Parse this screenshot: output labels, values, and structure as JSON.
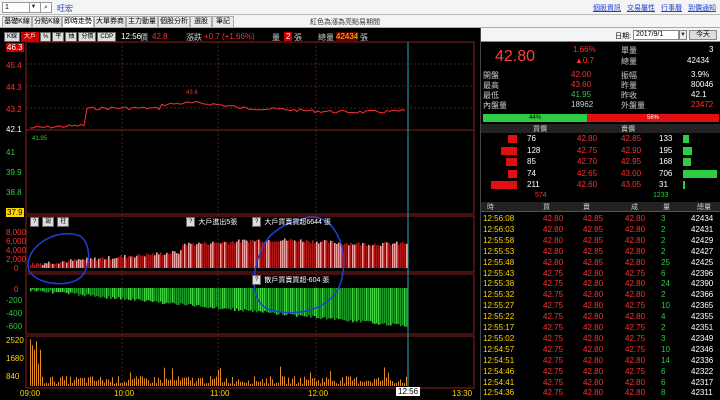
{
  "topbar": {
    "symbol": "1",
    "stock_name": "旺宏",
    "links": [
      "個股資訊",
      "交易屬性",
      "行事曆",
      "到價通知"
    ]
  },
  "tabs": [
    "基礎K線",
    "分點K線",
    "即時走勢",
    "大單券商",
    "主力動量",
    "個股分析",
    "選股",
    "筆記"
  ],
  "active_tab": 2,
  "notice": "紅色為漲為亮點易期間",
  "toolbar": {
    "buttons": [
      "K線",
      "大戶",
      "%",
      "平",
      "抽",
      "分價",
      "CDP"
    ],
    "clock": "12:56",
    "price_label": "價",
    "price": "42.8",
    "change_label": "漲跌",
    "change": "+0.7 (+1.66%)",
    "vol_label": "量",
    "vol": "2",
    "total_label": "總量",
    "total": "42434",
    "total_unit": "張"
  },
  "price_axis": [
    "46.3",
    "45.4",
    "44.3",
    "43.2",
    "42.1"
  ],
  "price_peak": "43.6",
  "low_price_label": "41.95",
  "sub_axis": [
    "41",
    "39.9",
    "38.8",
    "37.9"
  ],
  "big_in_label": "大戶進出5張",
  "buy_label": "大戶買賣買超6644 張",
  "sell_label": "散戶買賣買超-604 張",
  "big_axis": [
    "8,000",
    "6,000",
    "4,000",
    "2,000",
    "0"
  ],
  "diff_axis": [
    "0",
    "-200",
    "-400",
    "-600"
  ],
  "vol_axis": [
    "2520",
    "1680",
    "840"
  ],
  "time_axis": [
    "09:00",
    "10:00",
    "11:00",
    "12:00",
    "13:30"
  ],
  "cursor_time": "12:56",
  "right": {
    "date_label": "日期:",
    "date_value": "2017/9/1",
    "today_label": "今天",
    "price": "42.80",
    "change_pct": "1.66%",
    "change_amt": "▲0.7",
    "single_label": "單量",
    "single": "3",
    "total_label": "總量",
    "total": "42434",
    "rows": [
      {
        "l1": "開盤",
        "v1": "42.00",
        "l2": "振幅",
        "v2": "3.9%"
      },
      {
        "l1": "最高",
        "v1": "43.60",
        "l2": "昨量",
        "v2": "80046"
      },
      {
        "l1": "最低",
        "v1": "41.95",
        "l2": "昨收",
        "v2": "42.1"
      },
      {
        "l1": "內盤量",
        "v1": "18962",
        "l2": "外盤量",
        "v2": "23472"
      }
    ],
    "bar_left_pct": "44%",
    "bar_right_pct": "56%",
    "buy_head": "買價",
    "sell_head": "賣價",
    "ladder": [
      {
        "bq": "76",
        "bp": "42.80",
        "sp": "42.85",
        "sq": "133"
      },
      {
        "bq": "128",
        "bp": "42.75",
        "sp": "42.90",
        "sq": "195"
      },
      {
        "bq": "85",
        "bp": "42.70",
        "sp": "42.95",
        "sq": "168"
      },
      {
        "bq": "74",
        "bp": "42.65",
        "sp": "43.00",
        "sq": "706"
      },
      {
        "bq": "211",
        "bp": "42.60",
        "sp": "43.05",
        "sq": "31"
      }
    ],
    "ladder_buy_total": "574",
    "ladder_sell_total": "1233",
    "tick_headers": [
      "時",
      "買",
      "賣",
      "成",
      "量",
      "總量"
    ],
    "ticks": [
      [
        "12:56:08",
        "42.80",
        "42.85",
        "42.80",
        "3",
        "42434"
      ],
      [
        "12:56:03",
        "42.80",
        "42.85",
        "42.80",
        "2",
        "42431"
      ],
      [
        "12:55:58",
        "42.80",
        "42.85",
        "42.80",
        "2",
        "42429"
      ],
      [
        "12:55:53",
        "42.80",
        "42.85",
        "42.80",
        "2",
        "42427"
      ],
      [
        "12:55:48",
        "42.80",
        "42.85",
        "42.80",
        "25",
        "42425"
      ],
      [
        "12:55:43",
        "42.75",
        "42.80",
        "42.75",
        "6",
        "42396"
      ],
      [
        "12:55:38",
        "42.75",
        "42.80",
        "42.80",
        "24",
        "42390"
      ],
      [
        "12:55:32",
        "42.75",
        "42.80",
        "42.80",
        "2",
        "42366"
      ],
      [
        "12:55:27",
        "42.75",
        "42.80",
        "42.75",
        "10",
        "42365"
      ],
      [
        "12:55:22",
        "42.75",
        "42.80",
        "42.80",
        "4",
        "42355"
      ],
      [
        "12:55:17",
        "42.75",
        "42.80",
        "42.75",
        "2",
        "42351"
      ],
      [
        "12:55:02",
        "42.75",
        "42.80",
        "42.75",
        "3",
        "42349"
      ],
      [
        "12:54:57",
        "42.75",
        "42.80",
        "42.75",
        "10",
        "42346"
      ],
      [
        "12:54:51",
        "42.75",
        "42.80",
        "42.80",
        "14",
        "42336"
      ],
      [
        "12:54:46",
        "42.75",
        "42.80",
        "42.75",
        "6",
        "42322"
      ],
      [
        "12:54:41",
        "42.75",
        "42.80",
        "42.80",
        "6",
        "42317"
      ],
      [
        "12:54:36",
        "42.75",
        "42.80",
        "42.80",
        "8",
        "42311"
      ]
    ]
  },
  "colors": {
    "up": "#ff3030",
    "down": "#2ecc40",
    "yellow": "#ffd800",
    "bg": "#000000"
  }
}
